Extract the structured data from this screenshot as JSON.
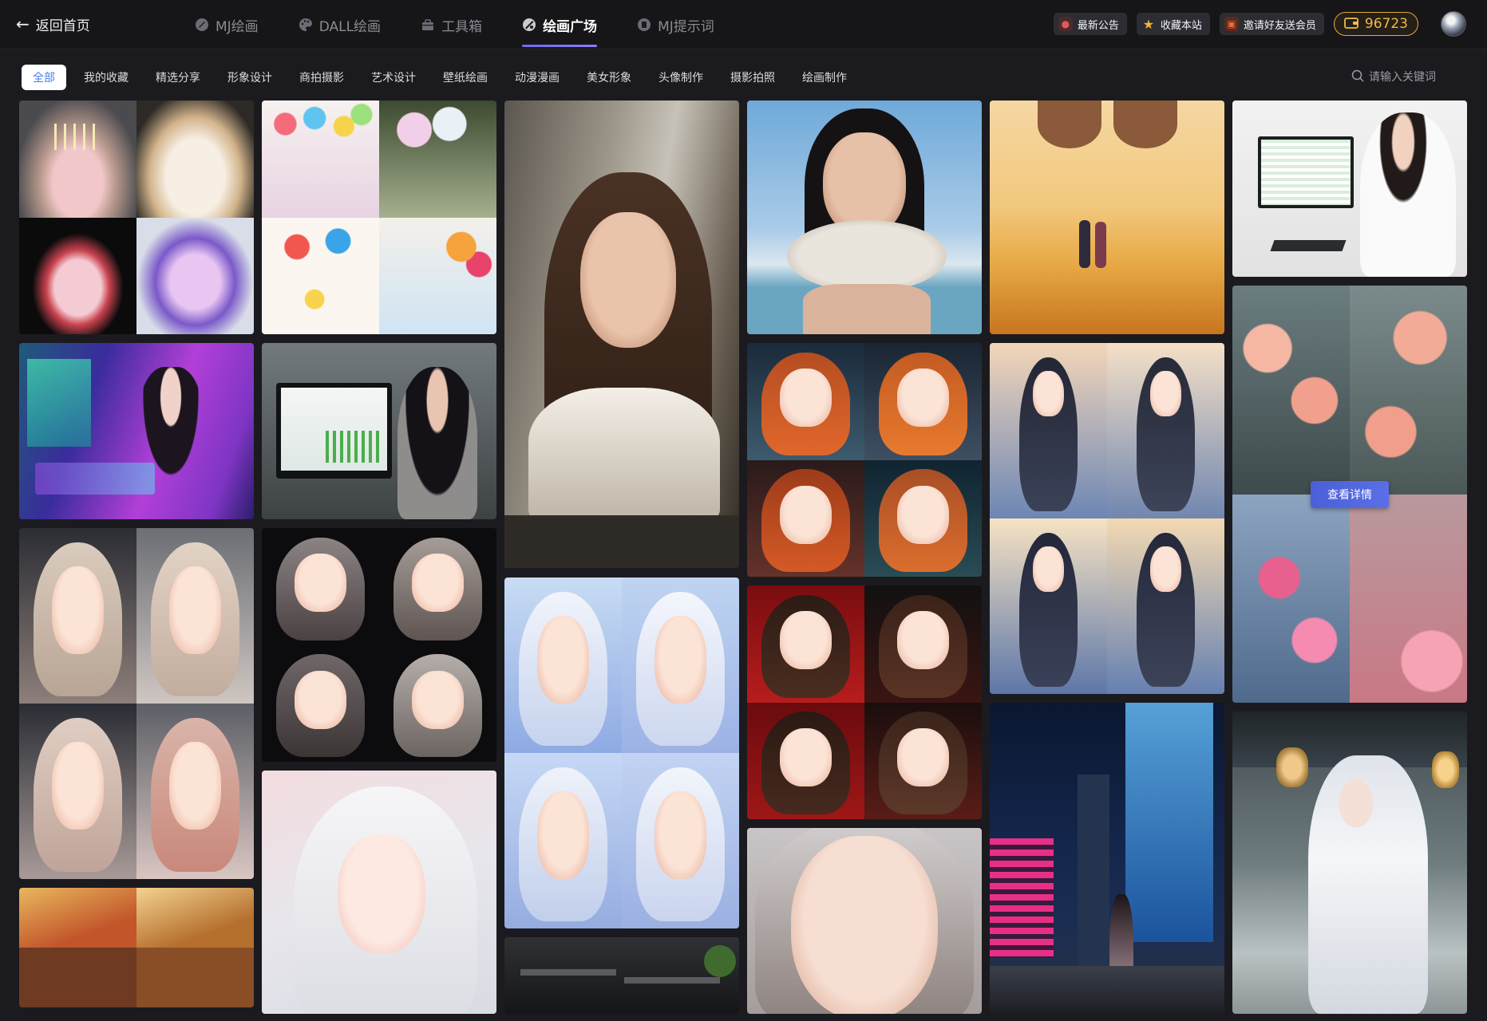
{
  "header": {
    "back_label": "返回首页",
    "nav": [
      {
        "label": "MJ绘画",
        "icon": "paint-brush-icon"
      },
      {
        "label": "DALL绘画",
        "icon": "palette-icon"
      },
      {
        "label": "工具箱",
        "icon": "toolbox-icon"
      },
      {
        "label": "绘画广场",
        "icon": "gallery-icon",
        "active": true
      },
      {
        "label": "MJ提示词",
        "icon": "prompt-icon"
      }
    ],
    "tools": [
      {
        "label": "最新公告",
        "icon": "announcement-icon",
        "color": "#e05a5a"
      },
      {
        "label": "收藏本站",
        "icon": "star-icon",
        "color": "#f2b531"
      },
      {
        "label": "邀请好友送会员",
        "icon": "gift-icon",
        "color": "#e2562e"
      }
    ],
    "coins": "96723"
  },
  "categories": [
    "全部",
    "我的收藏",
    "精选分享",
    "形象设计",
    "商拍摄影",
    "艺术设计",
    "壁纸绘画",
    "动漫漫画",
    "美女形象",
    "头像制作",
    "摄影拍照",
    "绘画制作"
  ],
  "active_category": "全部",
  "search": {
    "placeholder": "请输入关键词"
  },
  "overlay_button": "查看详情",
  "colors": {
    "accent": "#5a6fe7",
    "coin": "#f2b94a",
    "active_tab_text": "#4a7bf0"
  }
}
